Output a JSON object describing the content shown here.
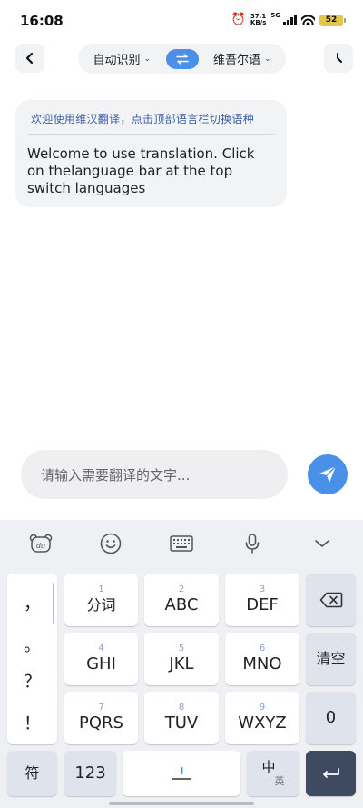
{
  "status_bar": {
    "time": "16:08",
    "speed_value": "37.1",
    "speed_unit": "KB/s",
    "network": "5G",
    "battery": "52"
  },
  "header": {
    "source_lang": "自动识别",
    "target_lang": "维吾尔语",
    "swap_icon": "swap-arrows-icon"
  },
  "welcome": {
    "chinese": "欢迎使用维汉翻译，点击顶部语言栏切换语种",
    "english": "Welcome to use translation. Click on thelanguage bar at the top switch languages"
  },
  "input": {
    "placeholder": "请输入需要翻译的文字..."
  },
  "keyboard": {
    "punctuation": [
      "，",
      "。",
      "？",
      "！"
    ],
    "keys": [
      {
        "num": "1",
        "label": "分词"
      },
      {
        "num": "2",
        "label": "ABC"
      },
      {
        "num": "3",
        "label": "DEF"
      },
      {
        "num": "4",
        "label": "GHI"
      },
      {
        "num": "5",
        "label": "JKL"
      },
      {
        "num": "6",
        "label": "MNO"
      },
      {
        "num": "7",
        "label": "PQRS"
      },
      {
        "num": "8",
        "label": "TUV"
      },
      {
        "num": "9",
        "label": "WXYZ"
      }
    ],
    "clear_label": "清空",
    "zero_label": "0",
    "symbol_label": "符",
    "numeric_label": "123",
    "lang_main": "中",
    "lang_sub": "英"
  },
  "colors": {
    "accent": "#4a90e8",
    "enter_key": "#3d4a60"
  }
}
